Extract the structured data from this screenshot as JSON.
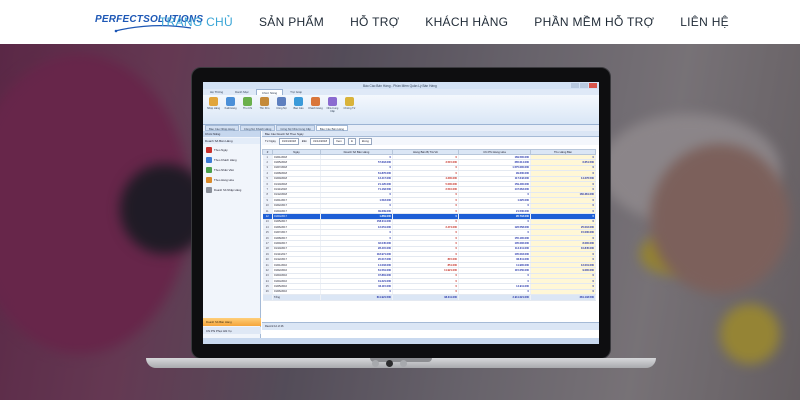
{
  "brand": {
    "logo_text": "PERFECTSOLUTIONS",
    "color": "#1d57b5"
  },
  "nav": {
    "items": [
      {
        "label": "TRANG CHỦ",
        "active": true
      },
      {
        "label": "SẢN PHẨM",
        "active": false
      },
      {
        "label": "HỖ TRỢ",
        "active": false
      },
      {
        "label": "KHÁCH HÀNG",
        "active": false
      },
      {
        "label": "PHẦN MỀM HỖ TRỢ",
        "active": false
      },
      {
        "label": "LIÊN HỆ",
        "active": false
      }
    ],
    "active_color": "#3aa5d6"
  },
  "hero": {
    "slider": {
      "count": 3,
      "active_index": 1
    }
  },
  "app": {
    "title": "Báo Cáo Bán Hàng - Phần Mềm Quản Lý Bán Hàng",
    "ribbon_tabs": [
      "Hệ Thống",
      "Danh Mục",
      "Chức Năng",
      "Trợ Giúp"
    ],
    "ribbon_buttons": [
      "Nhập Hàng",
      "Xuất Hàng",
      "Thu Chi",
      "Tồn Kho",
      "Công Nợ",
      "Báo Cáo",
      "Khách Hàng",
      "Nhà Cung Cấp",
      "Chứng Từ"
    ],
    "doc_tabs": [
      "Báo Cáo Nhập Hàng",
      "Công Nợ Khách Hàng",
      "Công Nợ Nhà Cung Cấp",
      "Báo Cáo Bán Hàng"
    ],
    "sidebar": {
      "header": "Chức Năng",
      "group": "Doanh Số Bán Hàng",
      "items": [
        "Theo Ngày",
        "Theo Khách Hàng",
        "Theo Nhân Viên",
        "Theo Hàng Hóa",
        "Doanh Số Nhập Hàng"
      ],
      "footer_primary": "Doanh Số Bán Hàng",
      "footer_secondary": "Chi Phí Phục Hồi Vụ"
    },
    "report": {
      "tab": "Báo Cáo Doanh Số Theo Ngày",
      "filter_from_label": "Từ Ngày",
      "filter_from": "01/01/2018",
      "filter_to_label": "Đến",
      "filter_to": "31/12/2018",
      "view_label": "Xem",
      "print_label": "In",
      "close_label": "Đóng",
      "columns": [
        "#",
        "Ngày",
        "Doanh Số Bán Hàng",
        "Hàng Bán Bị Trả Về",
        "Chi Phí Hàng Hóa",
        "Thu Hàng Bán"
      ],
      "rows": [
        [
          "1",
          "01/01/2018",
          "0",
          "0",
          "169.500.000",
          "0"
        ],
        [
          "2",
          "01/05/2018",
          "57.618.000",
          "3.515.000",
          "265.014.000",
          "6.651.500"
        ],
        [
          "3",
          "01/07/2018",
          "0",
          "0",
          "1.575.000.000",
          "0"
        ],
        [
          "4",
          "01/08/2018",
          "61.876.000",
          "0",
          "99.600.000",
          "0"
        ],
        [
          "5",
          "01/09/2018",
          "13.417.000",
          "4.200.000",
          "117.642.000",
          "14.276.500"
        ],
        [
          "6",
          "01/10/2018",
          "21.120.000",
          "5.000.000",
          "159.400.000",
          "0"
        ],
        [
          "7",
          "01/11/2018",
          "71.163.500",
          "2.510.000",
          "147.063.000",
          "0"
        ],
        [
          "8",
          "01/12/2018",
          "0",
          "0",
          "0",
          "160.381.000"
        ],
        [
          "9",
          "01/01/2017",
          "1.518.000",
          "0",
          "1.025.000",
          "0"
        ],
        [
          "10",
          "01/02/2017",
          "0",
          "0",
          "0",
          "0"
        ],
        [
          "11",
          "01/03/2017",
          "39.609.000",
          "0",
          "21.500.000",
          "0"
        ],
        [
          "12",
          "01/04/2017",
          "1.869.000",
          "0",
          "95.718.000",
          "0"
        ],
        [
          "13",
          "01/05/2017",
          "158.011.000",
          "0",
          "0",
          "0"
        ],
        [
          "14",
          "01/06/2017",
          "12.051.000",
          "2.474.000",
          "126.558.000",
          "25.016.000"
        ],
        [
          "15",
          "01/07/2017",
          "0",
          "0",
          "0",
          "15.000.000"
        ],
        [
          "16",
          "01/08/2017",
          "0",
          "0",
          "155.100.000",
          "0"
        ],
        [
          "17",
          "01/09/2017",
          "32.045.000",
          "0",
          "105.006.000",
          "8.000.000"
        ],
        [
          "18",
          "01/10/2017",
          "28.415.000",
          "0",
          "114.011.000",
          "10.845.000"
        ],
        [
          "19",
          "01/11/2017",
          "118.971.000",
          "0",
          "105.003.000",
          "0"
        ],
        [
          "20",
          "01/12/2017",
          "20.017.000",
          "815.000",
          "36.611.000",
          "0"
        ],
        [
          "21",
          "01/01/2016",
          "14.003.000",
          "851.000",
          "11.900.000",
          "12.001.000"
        ],
        [
          "22",
          "01/02/2016",
          "61.561.000",
          "11.921.000",
          "115.050.000",
          "9.000.000"
        ],
        [
          "23",
          "01/03/2016",
          "37.881.000",
          "0",
          "0",
          "0"
        ],
        [
          "24",
          "01/04/2016",
          "19.221.000",
          "0",
          "0",
          "0"
        ],
        [
          "25",
          "01/05/2016",
          "33.115.000",
          "0",
          "14.911.000",
          "0"
        ],
        [
          "26",
          "01/06/2016",
          "0",
          "0",
          "0",
          "0"
        ]
      ],
      "selected_row": 12,
      "totals": [
        "",
        "Tổng",
        "611.921.500",
        "38.311.000",
        "3.911.021.000",
        "281.148.500"
      ],
      "pager": "Record 12 of 26"
    }
  }
}
